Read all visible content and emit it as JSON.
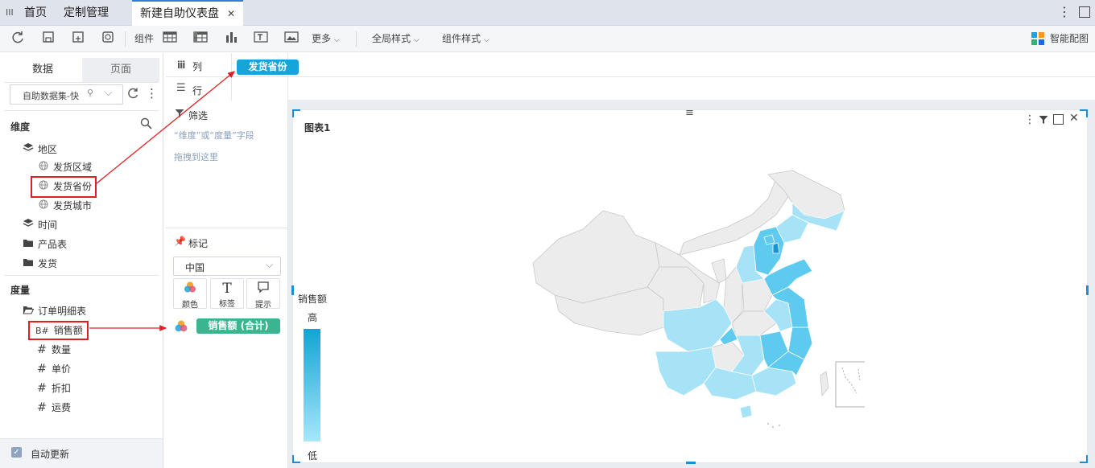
{
  "tabs": {
    "menu_glyph": "III",
    "home": "首页",
    "custom_mgmt": "定制管理",
    "active": "新建自助仪表盘",
    "close": "✕"
  },
  "toolbar": {
    "component_label": "组件",
    "more_label": "更多",
    "global_style_label": "全局样式",
    "component_style_label": "组件样式",
    "smart_chart_label": "智能配图"
  },
  "left": {
    "tab_data": "数据",
    "tab_page": "页面",
    "dataset_select": "自助数据集-快",
    "dimension_title": "维度",
    "dimensions": [
      {
        "label": "地区",
        "icon": "layers-icon"
      },
      {
        "label": "发货区域",
        "icon": "globe-icon"
      },
      {
        "label": "发货省份",
        "icon": "globe-icon"
      },
      {
        "label": "发货城市",
        "icon": "globe-icon"
      },
      {
        "label": "时间",
        "icon": "layers-icon"
      },
      {
        "label": "产品表",
        "icon": "folder-icon"
      },
      {
        "label": "发货",
        "icon": "folder-icon"
      }
    ],
    "measure_title": "度量",
    "measures": [
      {
        "label": "订单明细表",
        "icon": "folder-open-icon"
      },
      {
        "label": "销售额",
        "icon": "hash-icon",
        "prefix": "B#"
      },
      {
        "label": "数量",
        "icon": "hash-icon"
      },
      {
        "label": "单价",
        "icon": "hash-icon"
      },
      {
        "label": "折扣",
        "icon": "hash-icon"
      },
      {
        "label": "运费",
        "icon": "hash-icon"
      }
    ],
    "auto_update": "自动更新"
  },
  "middle": {
    "col_label": "列",
    "row_label": "行",
    "col_pill": "发货省份",
    "filter_title": "筛选",
    "filter_hint_1": "“维度”或“度量”字段",
    "filter_hint_2": "拖拽到这里",
    "mark_title": "标记",
    "mark_select": "中国",
    "mark_color": "颜色",
    "mark_label": "标签",
    "mark_tooltip": "提示",
    "measure_pill": "销售额 (合计)"
  },
  "chart": {
    "title": "图表1",
    "legend_title": "销售额",
    "legend_high": "高",
    "legend_low": "低"
  },
  "colors": {
    "accent_blue": "#1a8fd4",
    "pill_blue": "#17a5d8",
    "pill_green": "#3bb58f",
    "annotation_red": "#e02020",
    "map_light": "#a6e3f7",
    "map_mid": "#5fcaf0",
    "map_dark": "#1b93d1"
  }
}
